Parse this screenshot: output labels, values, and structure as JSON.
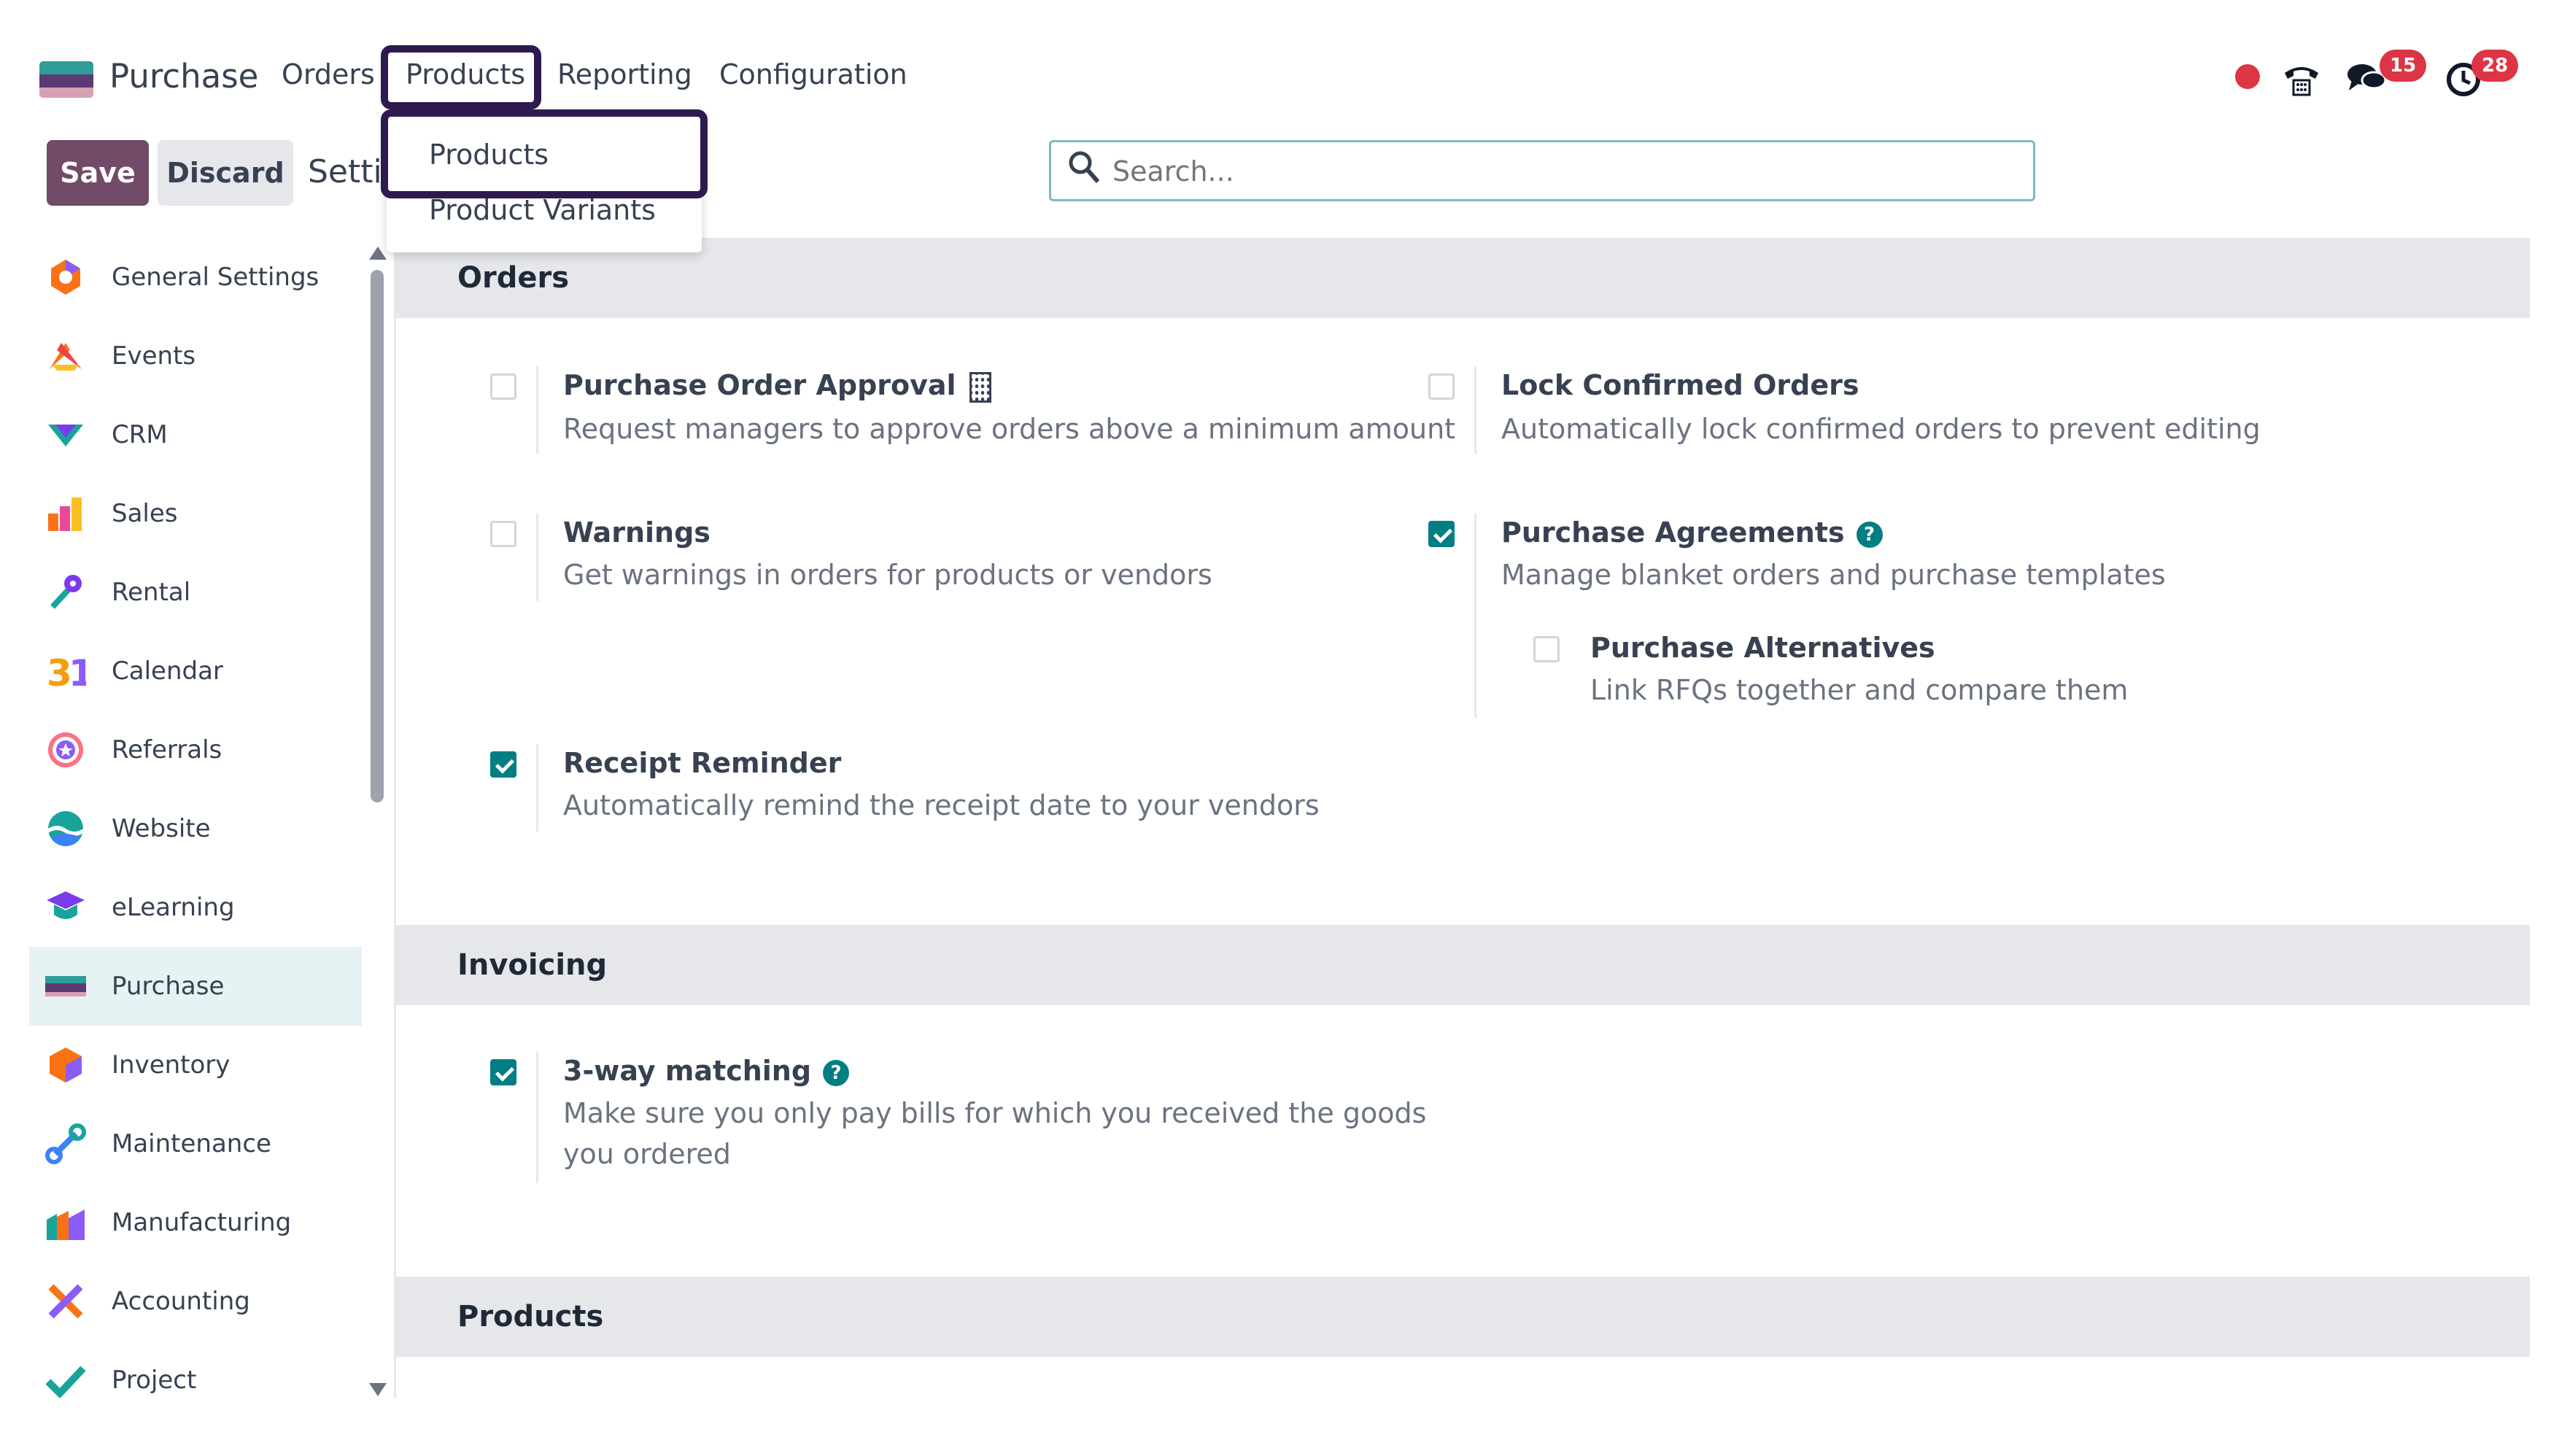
{
  "topnav": {
    "app_name": "Purchase",
    "menu": [
      "Orders",
      "Products",
      "Reporting",
      "Configuration"
    ],
    "messages_count": "15",
    "activities_count": "28",
    "icons": [
      "record-icon",
      "phone-icon",
      "chat-icon",
      "clock-icon"
    ]
  },
  "toolbar": {
    "save_label": "Save",
    "discard_label": "Discard",
    "breadcrumb": "Settings"
  },
  "search": {
    "placeholder": "Search..."
  },
  "dropdown": {
    "items": [
      "Products",
      "Product Variants"
    ]
  },
  "sidebar": {
    "items": [
      {
        "label": "General Settings",
        "icon": "general-settings-icon"
      },
      {
        "label": "Events",
        "icon": "events-icon"
      },
      {
        "label": "CRM",
        "icon": "crm-icon"
      },
      {
        "label": "Sales",
        "icon": "sales-icon"
      },
      {
        "label": "Rental",
        "icon": "rental-icon"
      },
      {
        "label": "Calendar",
        "icon": "calendar-icon"
      },
      {
        "label": "Referrals",
        "icon": "referrals-icon"
      },
      {
        "label": "Website",
        "icon": "website-icon"
      },
      {
        "label": "eLearning",
        "icon": "elearning-icon"
      },
      {
        "label": "Purchase",
        "icon": "purchase-icon"
      },
      {
        "label": "Inventory",
        "icon": "inventory-icon"
      },
      {
        "label": "Maintenance",
        "icon": "maintenance-icon"
      },
      {
        "label": "Manufacturing",
        "icon": "manufacturing-icon"
      },
      {
        "label": "Accounting",
        "icon": "accounting-icon"
      },
      {
        "label": "Project",
        "icon": "project-icon"
      }
    ],
    "active": "Purchase"
  },
  "sections": {
    "orders": {
      "title": "Orders",
      "settings": [
        {
          "title": "Purchase Order Approval",
          "desc": "Request managers to approve orders above a minimum amount",
          "checked": false
        },
        {
          "title": "Lock Confirmed Orders",
          "desc": "Automatically lock confirmed orders to prevent editing",
          "checked": false
        },
        {
          "title": "Warnings",
          "desc": "Get warnings in orders for products or vendors",
          "checked": false
        },
        {
          "title": "Purchase Agreements",
          "desc": "Manage blanket orders and purchase templates",
          "checked": true
        },
        {
          "title": "Purchase Alternatives",
          "desc": "Link RFQs together and compare them",
          "checked": false
        },
        {
          "title": "Receipt Reminder",
          "desc": "Automatically remind the receipt date to your vendors",
          "checked": true
        }
      ]
    },
    "invoicing": {
      "title": "Invoicing",
      "settings": [
        {
          "title": "3-way matching",
          "desc_line1": "Make sure you only pay bills for which you received the goods",
          "desc_line2": "you ordered",
          "checked": true
        }
      ]
    },
    "products": {
      "title": "Products"
    }
  },
  "colors": {
    "brand": "#714b67",
    "accent": "#017e84",
    "highlight_box": "#2f1a4f",
    "badge": "#dc3545"
  }
}
